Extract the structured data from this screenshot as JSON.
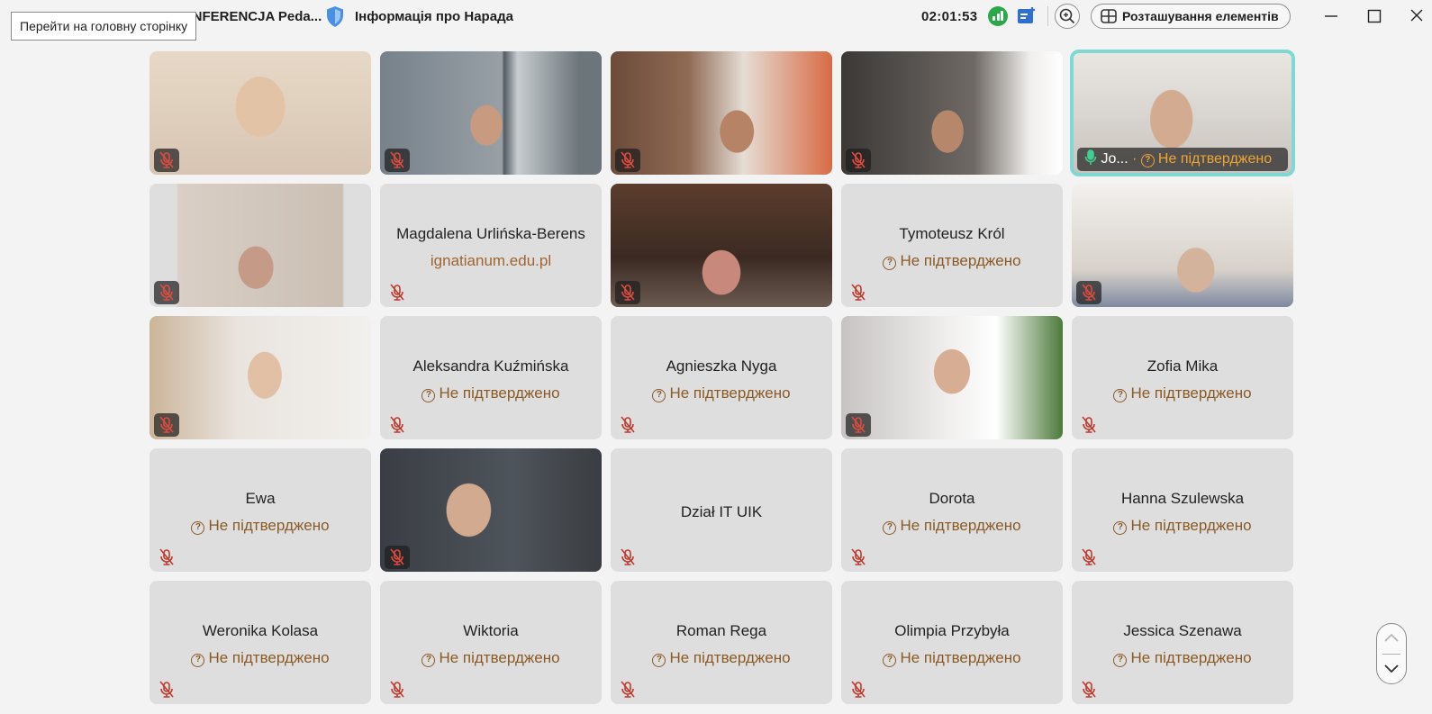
{
  "window": {
    "app_title": "MIĘDZYNARODOWA KONFERENCJA Peda...",
    "tooltip": "Перейти на головну сторінку",
    "meeting_info_label": "Інформація про Нарада",
    "timer": "02:01:53",
    "layout_label": "Розташування елементів"
  },
  "colors": {
    "tile_bg": "#dedede",
    "status_text": "#8a5a25",
    "mute_red": "#c0392b",
    "active_border": "#7fd8d1",
    "signal_green": "#2aa84a"
  },
  "participants": [
    {
      "name": "",
      "status": "",
      "video": true,
      "muted": true
    },
    {
      "name": "",
      "status": "",
      "video": true,
      "muted": true
    },
    {
      "name": "",
      "status": "",
      "video": true,
      "muted": true
    },
    {
      "name": "",
      "status": "",
      "video": true,
      "muted": true
    },
    {
      "name": "Jo...",
      "status": "Не підтверджено",
      "video": true,
      "speaking": true,
      "active": true
    },
    {
      "name": "",
      "status": "",
      "video": true,
      "muted": true
    },
    {
      "name": "Magdalena Urlińska-Berens",
      "status": "ignatianum.edu.pl",
      "video": false,
      "muted": true
    },
    {
      "name": "",
      "status": "",
      "video": true,
      "muted": true
    },
    {
      "name": "Tymoteusz Król",
      "status": "Не підтверджено",
      "video": false,
      "muted": true
    },
    {
      "name": "",
      "status": "",
      "video": true,
      "muted": true
    },
    {
      "name": "",
      "status": "",
      "video": true,
      "muted": true
    },
    {
      "name": "Aleksandra Kuźmińska",
      "status": "Не підтверджено",
      "video": false,
      "muted": true
    },
    {
      "name": "Agnieszka Nyga",
      "status": "Не підтверджено",
      "video": false,
      "muted": true
    },
    {
      "name": "",
      "status": "",
      "video": true,
      "muted": true
    },
    {
      "name": "Zofia Mika",
      "status": "Не підтверджено",
      "video": false,
      "muted": true
    },
    {
      "name": "Ewa",
      "status": "Не підтверджено",
      "video": false,
      "muted": true
    },
    {
      "name": "",
      "status": "",
      "video": true,
      "muted": true
    },
    {
      "name": "Dział IT UIK",
      "status": "",
      "video": false,
      "muted": true
    },
    {
      "name": "Dorota",
      "status": "Не підтверджено",
      "video": false,
      "muted": true
    },
    {
      "name": "Hanna Szulewska",
      "status": "Не підтверджено",
      "video": false,
      "muted": true
    },
    {
      "name": "Weronika Kolasa",
      "status": "Не підтверджено",
      "video": false,
      "muted": true
    },
    {
      "name": "Wiktoria",
      "status": "Не підтверджено",
      "video": false,
      "muted": true
    },
    {
      "name": "Roman Rega",
      "status": "Не підтверджено",
      "video": false,
      "muted": true
    },
    {
      "name": "Olimpia Przybyła",
      "status": "Не підтверджено",
      "video": false,
      "muted": true
    },
    {
      "name": "Jessica Szenawa",
      "status": "Не підтверджено",
      "video": false,
      "muted": true
    }
  ],
  "icons": {
    "shield": "shield-icon",
    "signal": "network-signal-icon",
    "board": "whiteboard-icon",
    "zoom": "zoom-in-icon",
    "layout": "grid-layout-icon",
    "minimize": "minimize-icon",
    "maximize": "maximize-icon",
    "close": "close-icon",
    "mic_muted": "mic-muted-icon",
    "mic_on": "mic-icon",
    "unverified": "question-circle-icon",
    "scroll_up": "chevron-up-icon",
    "scroll_down": "chevron-down-icon"
  }
}
